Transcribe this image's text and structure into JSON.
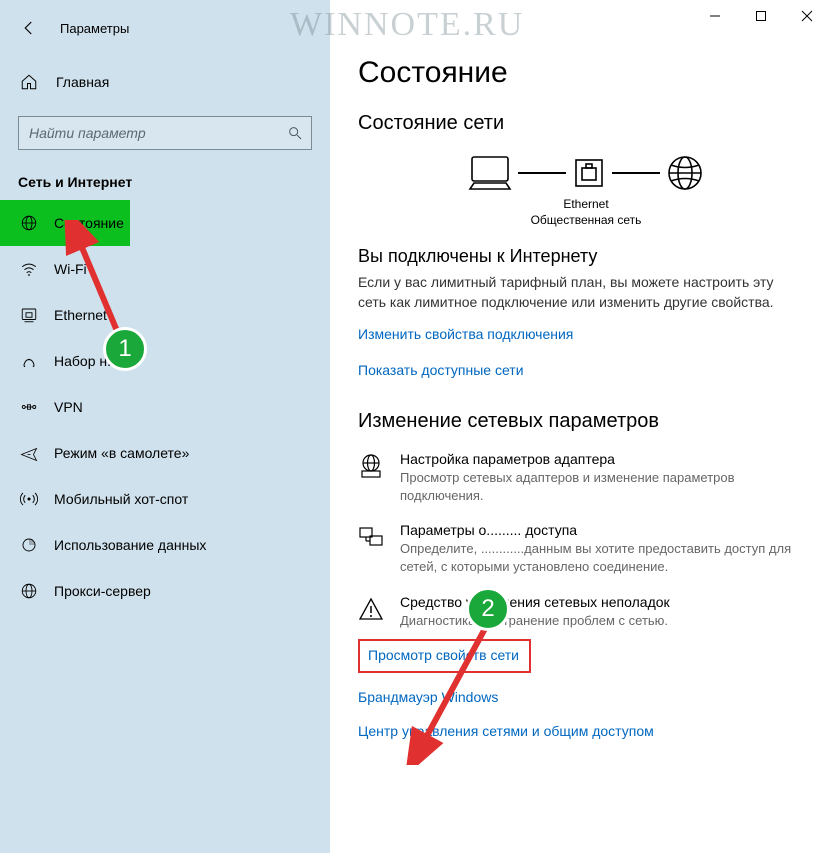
{
  "window": {
    "title": "Параметры"
  },
  "watermark": "WINNOTE.RU",
  "sidebar": {
    "home": "Главная",
    "search_placeholder": "Найти параметр",
    "category": "Сеть и Интернет",
    "items": [
      {
        "label": "Состояние"
      },
      {
        "label": "Wi-Fi"
      },
      {
        "label": "Ethernet"
      },
      {
        "label": "Набор н..."
      },
      {
        "label": "VPN"
      },
      {
        "label": "Режим «в самолете»"
      },
      {
        "label": "Мобильный хот-спот"
      },
      {
        "label": "Использование данных"
      },
      {
        "label": "Прокси-сервер"
      }
    ]
  },
  "main": {
    "page_title": "Состояние",
    "status_heading": "Состояние сети",
    "diagram": {
      "eth_label": "Ethernet",
      "eth_sub": "Общественная сеть"
    },
    "connected_title": "Вы подключены к Интернету",
    "connected_body": "Если у вас лимитный тарифный план, вы можете настроить эту сеть как лимитное подключение или изменить другие свойства.",
    "link_change_props": "Изменить свойства подключения",
    "link_show_nets": "Показать доступные сети",
    "change_heading": "Изменение сетевых параметров",
    "opts": [
      {
        "title": "Настройка параметров адаптера",
        "desc": "Просмотр сетевых адаптеров и изменение параметров подключения."
      },
      {
        "title": "Параметры о......... доступа",
        "desc": "Определите, ............данным вы хотите предоставить доступ для сетей, с которыми установлено соединение."
      },
      {
        "title": "Средство устранения сетевых неполадок",
        "desc": "Диагностика и устранение проблем с сетью."
      }
    ],
    "link_view_props": "Просмотр свойств сети",
    "link_firewall": "Брандмауэр Windows",
    "link_control": "Центр управления сетями и общим доступом"
  },
  "badges": {
    "one": "1",
    "two": "2"
  }
}
